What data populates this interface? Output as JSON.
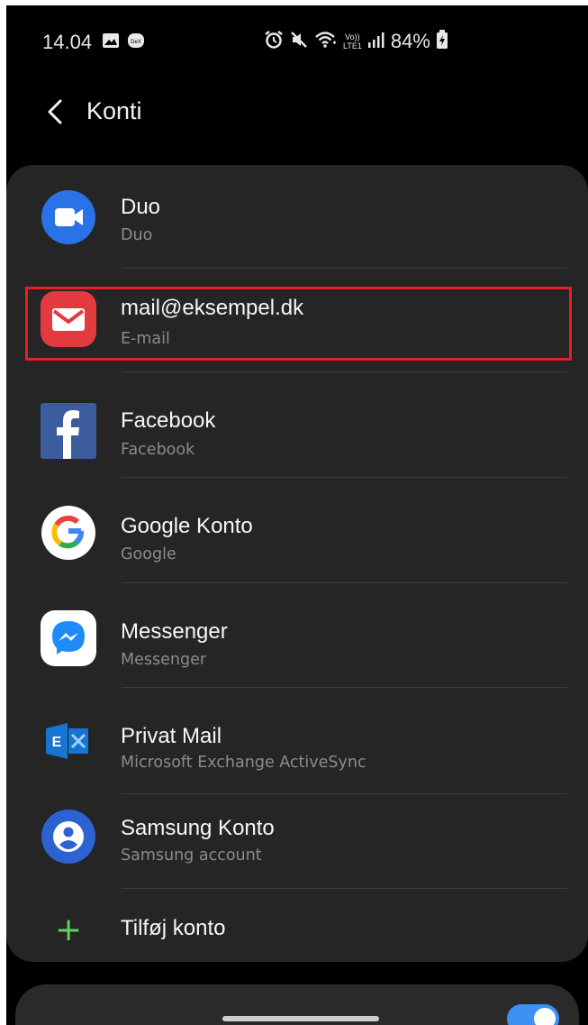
{
  "status_bar": {
    "time": "14.04",
    "battery_percent": "84%",
    "network_label_top": "Vo))",
    "network_label_bottom": "LTE1",
    "icons": [
      "gallery-icon",
      "dex-icon",
      "alarm-icon",
      "mute-icon",
      "wifi-icon",
      "signal-icon",
      "battery-charging-icon"
    ]
  },
  "header": {
    "title": "Konti",
    "back_icon": "chevron-left-icon"
  },
  "accounts": [
    {
      "title": "Duo",
      "subtitle": "Duo",
      "icon": "duo-icon",
      "color": "#2a72e8"
    },
    {
      "title": "mail@eksempel.dk",
      "subtitle": "E-mail",
      "icon": "email-icon",
      "color": "#e23a3f"
    },
    {
      "title": "Facebook",
      "subtitle": "Facebook",
      "icon": "facebook-icon",
      "color": "#3d5c9e"
    },
    {
      "title": "Google Konto",
      "subtitle": "Google",
      "icon": "google-icon",
      "color": "#ffffff"
    },
    {
      "title": "Messenger",
      "subtitle": "Messenger",
      "icon": "messenger-icon",
      "color": "#1f8bf8"
    },
    {
      "title": "Privat Mail",
      "subtitle": "Microsoft Exchange ActiveSync",
      "icon": "exchange-icon",
      "color": "#1774d1"
    },
    {
      "title": "Samsung Konto",
      "subtitle": "Samsung account",
      "icon": "samsung-account-icon",
      "color": "#2d62d3"
    }
  ],
  "add_account": {
    "label": "Tilføj konto",
    "icon": "plus-icon",
    "color": "#5fd257"
  },
  "highlight_color": "#e41f26",
  "sync_toggle": {
    "state": "on",
    "color": "#3e91f2"
  }
}
